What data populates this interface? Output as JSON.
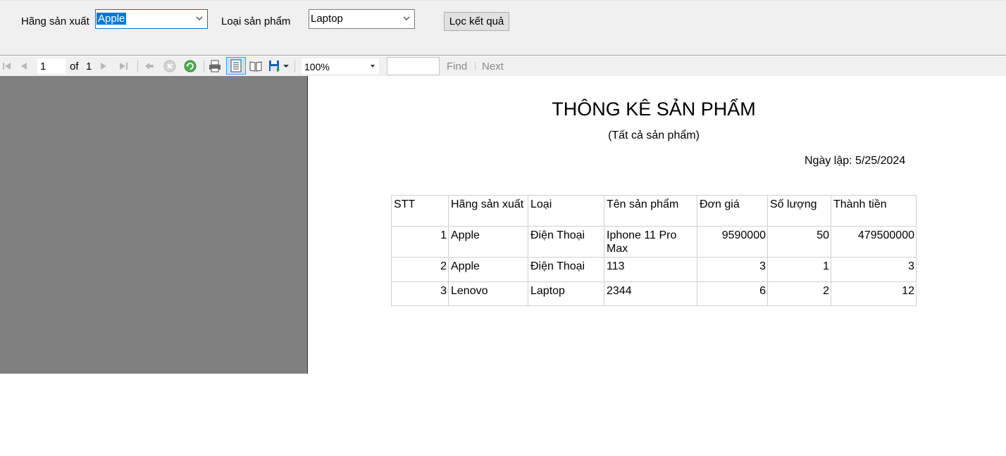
{
  "filters": {
    "manufacturer_label": "Hãng sản xuất",
    "manufacturer_value": "Apple",
    "category_label": "Loại sản phẩm",
    "category_value": "Laptop",
    "filter_button": "Lọc kết quả"
  },
  "toolbar": {
    "page_number": "1",
    "of_label": "of",
    "total_pages": "1",
    "zoom": "100%",
    "find_text": "",
    "find_label": "Find",
    "next_label": "Next"
  },
  "report": {
    "title": "THÔNG KÊ SẢN PHẨM",
    "subtitle": "(Tất cả sản phẩm)",
    "date_line": "Ngày lập: 5/25/2024",
    "headers": [
      "STT",
      "Hãng sản xuất",
      "Loại",
      "Tên sản phẩm",
      "Đơn giá",
      "Số lượng",
      "Thành tiền"
    ],
    "rows": [
      [
        "1",
        "Apple",
        "Điện Thoại",
        "Iphone 11 Pro Max",
        "9590000",
        "50",
        "479500000"
      ],
      [
        "2",
        "Apple",
        "Điện Thoại",
        "113",
        "3",
        "1",
        "3"
      ],
      [
        "3",
        "Lenovo",
        "Laptop",
        "2344",
        "6",
        "2",
        "12"
      ]
    ]
  },
  "colors": {
    "selection": "#0078d7",
    "panel_bg": "#f0f0f0",
    "viewer_gray": "#808080",
    "refresh_green": "#2e9e3e",
    "save_blue": "#1f5fb0"
  }
}
